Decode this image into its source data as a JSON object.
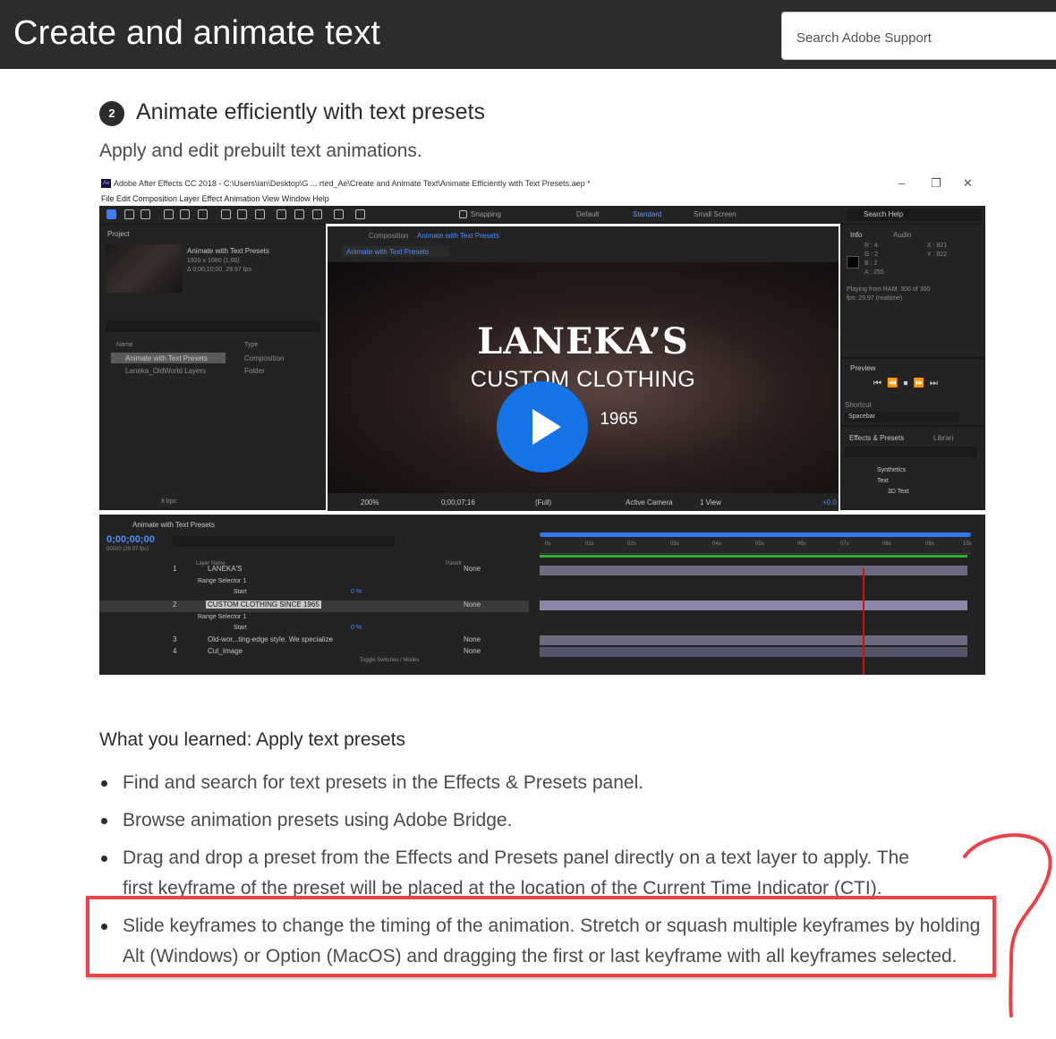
{
  "header": {
    "title": "Create and animate text",
    "search_placeholder": "Search Adobe Support"
  },
  "section": {
    "step_number": "2",
    "title": "Animate efficiently with text presets",
    "subtitle": "Apply and edit prebuilt text animations."
  },
  "video": {
    "window_title": "Adobe After Effects CC 2018 - C:\\Users\\ian\\Desktop\\G ... rted_Ae\\Create and Animate Text\\Animate Efficiently with Text Presets.aep *",
    "menu": "File  Edit  Composition  Layer  Effect  Animation  View  Window  Help",
    "workspaces": [
      "Default",
      "Standard",
      "Small Screen"
    ],
    "snapping": "Snapping",
    "search_help": "Search Help",
    "project_panel": "Project",
    "project_item": "Animate with Text Presets",
    "project_item_meta1": "1920 x 1080 (1.00)",
    "project_item_meta2": "Δ 0;00;10;00, 29.97 fps",
    "col_name": "Name",
    "col_type": "Type",
    "rows": [
      {
        "name": "Animate with Text Presets",
        "type": "Composition"
      },
      {
        "name": "Laneka_OldWorld Layers",
        "type": "Folder"
      }
    ],
    "bpc": "8 bpc",
    "comp_tab": "Composition",
    "comp_name": "Animate with Text Presets",
    "comp_subtab": "Animate with Text Presets",
    "viewer_line1": "LANEKA’S",
    "viewer_line2": "CUSTOM CLOTHING",
    "viewer_line3": "1965",
    "zoom": "200%",
    "viewer_time": "0;00;07;16",
    "resolution": "(Full)",
    "camera": "Active Camera",
    "view": "1 View",
    "exposure": "+0.0",
    "info_tab": "Info",
    "audio_tab": "Audio",
    "info_r": "R : 4",
    "info_g": "G : 2",
    "info_b": "B : 2",
    "info_a": "A : 255",
    "info_x": "X : 821",
    "info_y": "Y : 822",
    "info_playing": "Playing from RAM: 300 of 300",
    "info_fps": "fps: 29.97 (realtime)",
    "preview_tab": "Preview",
    "shortcut_label": "Shortcut",
    "shortcut_value": "Spacebar",
    "effects_tab": "Effects & Presets",
    "libraries_tab": "Librari",
    "effects_tree": [
      "Synthetics",
      "Text",
      "3D Text"
    ],
    "timeline_tab": "Animate with Text Presets",
    "timecode": "0;00;00;00",
    "timecode_sub": "00000 (29.97 fps)",
    "layer_col": "Layer Name",
    "parent_col": "Parent",
    "ruler": [
      "0s",
      "01s",
      "02s",
      "03s",
      "04s",
      "05s",
      "06s",
      "07s",
      "08s",
      "09s",
      "10s"
    ],
    "layers": [
      {
        "num": "1",
        "name": "LANEKA'S",
        "parent": "None"
      },
      {
        "num": "",
        "name": "Range Selector 1",
        "parent": ""
      },
      {
        "num": "",
        "name": "Start",
        "parent": "0 %"
      },
      {
        "num": "2",
        "name": "CUSTOM CLOTHING SINCE 1965",
        "parent": "None"
      },
      {
        "num": "",
        "name": "Range Selector 1",
        "parent": ""
      },
      {
        "num": "",
        "name": "Start",
        "parent": "0 %"
      },
      {
        "num": "3",
        "name": "Old-wor...ting-edge style. We specialize",
        "parent": "None"
      },
      {
        "num": "4",
        "name": "Cut_Image",
        "parent": "None"
      }
    ],
    "toggle_label": "Toggle Switches / Modes"
  },
  "learned": {
    "title": "What you learned: Apply text presets",
    "bullets": [
      "Find and search for text presets in the Effects & Presets panel.",
      "Browse animation presets using Adobe Bridge.",
      "Drag and drop a preset from the Effects and Presets panel directly on a text layer to apply. The first keyframe of the preset will be placed at the location of the Current Time Indicator (CTI).",
      "Slide keyframes to change the timing of the animation. Stretch or squash multiple keyframes by holding Alt (Windows) or Option (MacOS) and dragging the first or last keyframe with all keyframes selected."
    ]
  },
  "colors": {
    "header_bg": "#2c2c2c",
    "play_button": "#1473e6",
    "annotation": "#e8434a"
  }
}
